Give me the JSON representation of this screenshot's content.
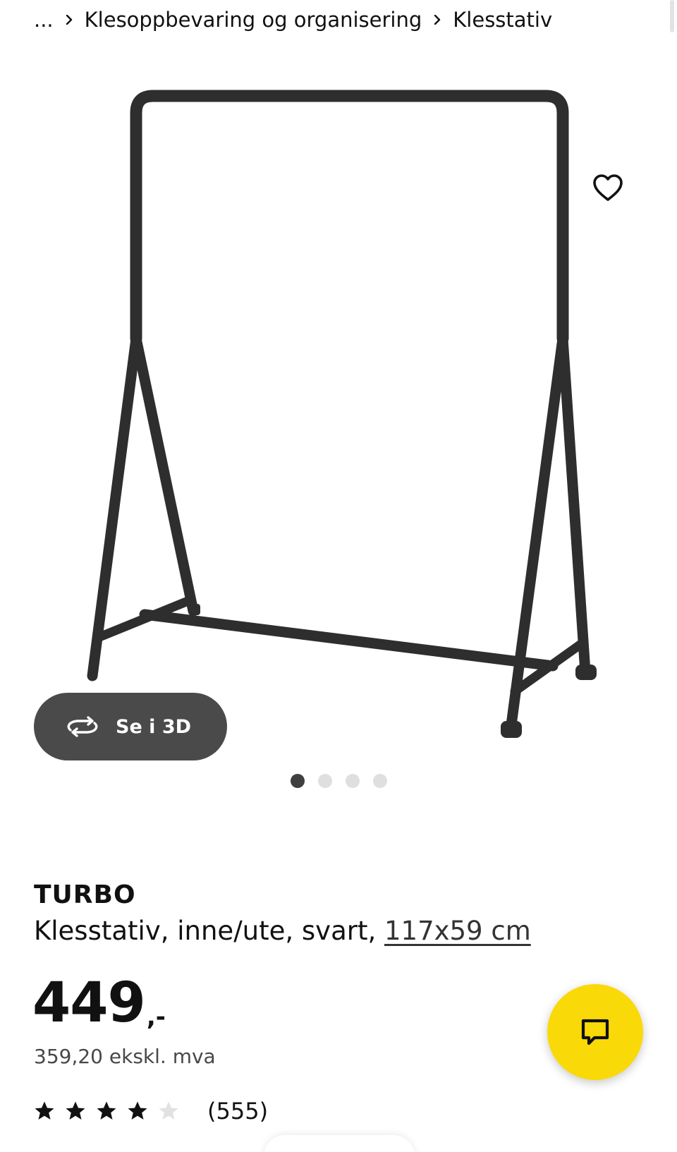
{
  "breadcrumb": {
    "ellipsis": "...",
    "items": [
      "Klesoppbevaring og organisering",
      "Klesstativ"
    ]
  },
  "image": {
    "btn_3d_label": "Se i 3D",
    "icons": {
      "favorite": "heart-outline-icon",
      "view_3d": "rotate-3d-icon"
    },
    "carousel": {
      "count": 4,
      "active_index": 0
    }
  },
  "product": {
    "name": "TURBO",
    "description": "Klesstativ, inne/ute, svart, ",
    "measure": "117x59 cm",
    "price_integer": "449",
    "price_suffix": ",-",
    "price_ex_vat": "359,20 ekskl. mva",
    "rating": {
      "value": 4,
      "max": 5,
      "review_count": "(555)"
    }
  },
  "chat": {
    "icon": "chat-bubble-icon",
    "color": "#FAD908"
  },
  "colors": {
    "dark_button": "#4A4A4A",
    "rack": "#2E2E2E",
    "dot_active": "#3F3F3F",
    "dot_inactive": "#DFDFDF"
  }
}
